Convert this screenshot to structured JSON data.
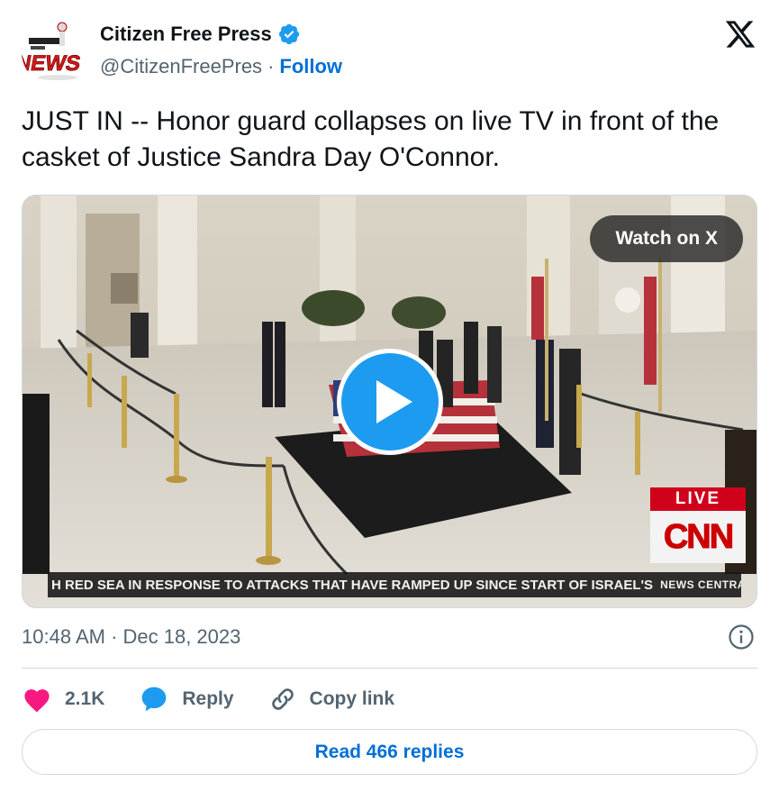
{
  "author": {
    "display_name": "Citizen Free Press",
    "handle": "@CitizenFreePres",
    "separator": "·",
    "follow_label": "Follow",
    "verified_color": "#1d9bf0",
    "avatar_text": "NEWS"
  },
  "tweet": {
    "text": "JUST IN -- Honor guard collapses on live TV in front of the casket of Justice Sandra Day O'Connor."
  },
  "media": {
    "watch_label": "Watch on X",
    "play_icon": "play-icon",
    "live_badge": "LIVE",
    "network_logo": "CNN",
    "ticker": "H RED SEA IN RESPONSE TO ATTACKS THAT HAVE RAMPED UP SINCE START OF ISRAEL'S",
    "ticker_brand": "NEWS CENTRAL"
  },
  "meta": {
    "timestamp": "10:48 AM · Dec 18, 2023"
  },
  "actions": {
    "like_count": "2.1K",
    "reply_label": "Reply",
    "copy_label": "Copy link"
  },
  "footer": {
    "read_replies_label": "Read 466 replies"
  },
  "colors": {
    "accent": "#1d9bf0",
    "link": "#006fd6",
    "like": "#f91880",
    "muted": "#536471",
    "live_red": "#d0021b"
  }
}
